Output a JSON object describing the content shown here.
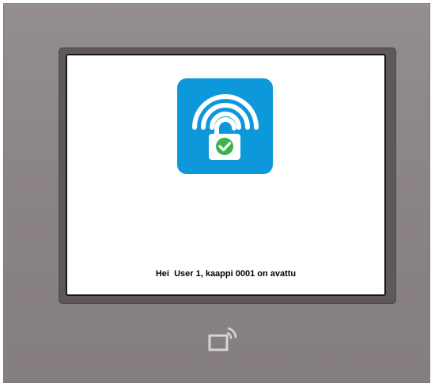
{
  "screen": {
    "message": "Hei  User 1, kaappi 0001 on avattu"
  },
  "icons": {
    "status": "unlocked-padlock-wireless-check-icon",
    "reader": "nfc-reader-icon"
  },
  "colors": {
    "device_frame": "#8f8888",
    "bezel": "#5e5858",
    "icon_background": "#0d98db",
    "check_green": "#3bb54a"
  }
}
